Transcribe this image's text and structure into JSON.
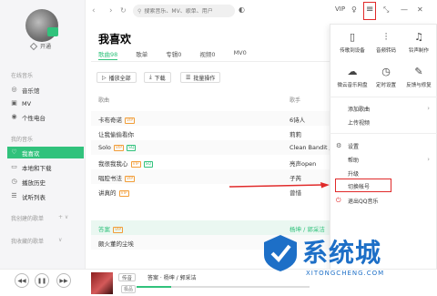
{
  "sidebar": {
    "open_vip": "开通",
    "online_section": "在线音乐",
    "online_items": [
      {
        "label": "音乐馆",
        "icon": "music-hall-icon"
      },
      {
        "label": "MV",
        "icon": "mv-icon"
      },
      {
        "label": "个性电台",
        "icon": "radio-icon"
      }
    ],
    "my_section": "我的音乐",
    "my_items": [
      {
        "label": "我喜欢",
        "icon": "heart-icon"
      },
      {
        "label": "本地和下载",
        "icon": "download-icon"
      },
      {
        "label": "播放历史",
        "icon": "history-icon"
      },
      {
        "label": "试听列表",
        "icon": "list-icon"
      }
    ],
    "created_section": "我创建的歌单",
    "collected_section": "我收藏的歌单"
  },
  "topbar": {
    "search_placeholder": "搜索音乐、MV、歌单、用户",
    "vip_label": "VIP"
  },
  "main": {
    "title": "我喜欢",
    "tabs": [
      "歌曲98",
      "歌单",
      "专辑0",
      "视频0",
      "MV0"
    ],
    "actions": {
      "play_all": "播放全部",
      "download": "下载",
      "batch": "批量操作"
    },
    "columns": {
      "song": "歌曲",
      "artist": "歌手"
    },
    "rows": [
      {
        "title": "卡布奇诺",
        "badge": "VIP",
        "badge_color": "orange",
        "artist": "6诗人"
      },
      {
        "title": "让我偷偷看你",
        "badge": "",
        "badge_color": "",
        "artist": "莉莉"
      },
      {
        "title": "Solo",
        "badge": "VIP",
        "badge_color": "orange",
        "artist": "Clean Bandit /"
      },
      {
        "title": "我很我我心",
        "badge": "VIP",
        "badge_color": "orange",
        "artist": "亮声open"
      },
      {
        "title": "唱腔书法",
        "badge": "VIP",
        "badge_color": "orange",
        "artist": "子芮"
      },
      {
        "title": "讲真的",
        "badge": "VIP",
        "badge_color": "orange",
        "artist": "曾惜"
      },
      {
        "title": "答案",
        "badge": "VIP",
        "badge_color": "orange",
        "artist": "杨坤 / 郭采洁"
      },
      {
        "title": "颇火董的尘埃",
        "badge": "",
        "badge_color": "",
        "artist": ""
      }
    ]
  },
  "player": {
    "chip": "传音",
    "song": "答案 · 杨坤 / 郭采洁",
    "speed": "极品",
    "progress": 0.2
  },
  "menu": {
    "grid": [
      {
        "label": "传歌到设备",
        "icon": "phone-transfer-icon"
      },
      {
        "label": "音频转码",
        "icon": "audio-convert-icon"
      },
      {
        "label": "铃声制作",
        "icon": "bell-icon"
      },
      {
        "label": "微云音乐网盘",
        "icon": "cloud-icon"
      },
      {
        "label": "定时设置",
        "icon": "clock-icon"
      },
      {
        "label": "反馈与修复",
        "icon": "feedback-icon"
      }
    ],
    "items": [
      {
        "label": "添加歌曲",
        "has_arrow": true
      },
      {
        "label": "上传视频",
        "has_arrow": false
      },
      {
        "label": "设置",
        "has_arrow": false
      },
      {
        "label": "帮助",
        "has_arrow": true
      },
      {
        "label": "升级",
        "has_arrow": false
      },
      {
        "label": "切换帐号",
        "has_arrow": false
      },
      {
        "label": "退出QQ音乐",
        "has_arrow": false
      }
    ]
  },
  "watermark": {
    "text": "系统城",
    "url": "XITONGCHENG.COM"
  },
  "colors": {
    "accent": "#31c27c",
    "highlight": "#e02a2a",
    "watermark": "#1d6fc7"
  }
}
